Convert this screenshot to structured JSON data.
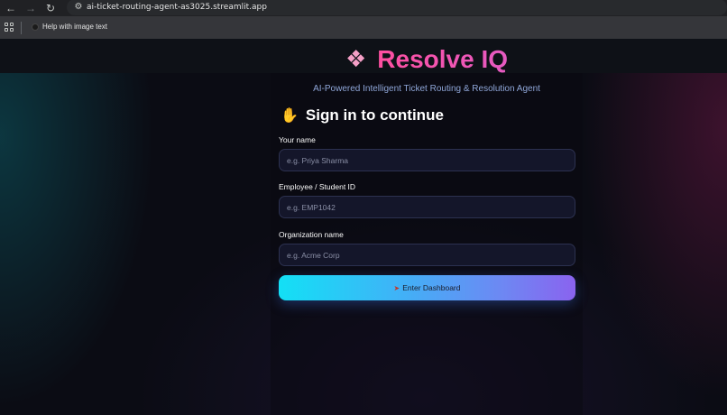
{
  "browser": {
    "url": "ai-ticket-routing-agent-as3025.streamlit.app",
    "bookmark_label": "Help with image text"
  },
  "header": {
    "title_icon": "brain-icon",
    "title": "Resolve IQ",
    "subtitle": "AI-Powered Intelligent Ticket Routing & Resolution Agent"
  },
  "signin": {
    "icon": "waving-hand-icon",
    "heading": "Sign in to continue"
  },
  "form": {
    "name_label": "Your name",
    "name_placeholder": "e.g. Priya Sharma",
    "id_label": "Employee / Student ID",
    "id_placeholder": "e.g. EMP1042",
    "org_label": "Organization name",
    "org_placeholder": "e.g. Acme Corp",
    "submit_icon": "rocket-icon",
    "submit_label": "Enter Dashboard"
  },
  "colors": {
    "title_gradient_start": "#ff4fa0",
    "title_gradient_end": "#e55ac2",
    "button_gradient_start": "#13e0f5",
    "button_gradient_end": "#8a63ef",
    "subtitle": "#8fa6d8"
  }
}
